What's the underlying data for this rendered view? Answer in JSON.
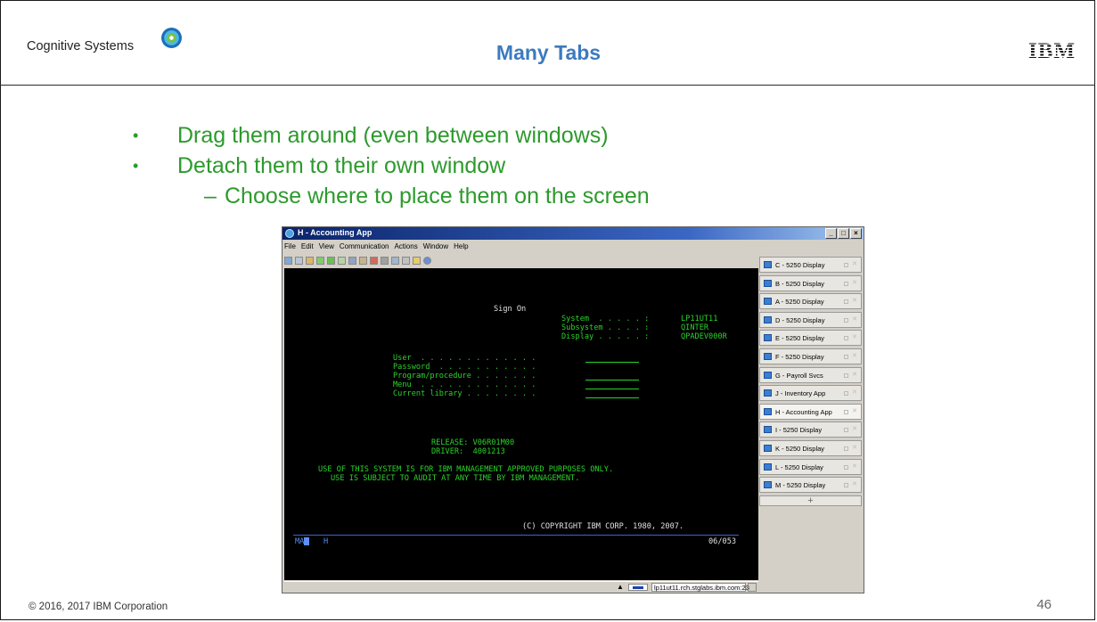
{
  "header": {
    "brand": "Cognitive Systems",
    "title": "Many Tabs",
    "ibm_logo": "IBM"
  },
  "bullets": [
    "Drag them around (even between windows)",
    "Detach them to their own window"
  ],
  "sub_bullets": [
    "Choose where to place them on the screen"
  ],
  "footer": {
    "copyright": "© 2016, 2017 IBM Corporation",
    "page_number": "46"
  },
  "app": {
    "title": "H - Accounting App",
    "window_buttons": [
      "_",
      "□",
      "×"
    ],
    "menu": [
      "File",
      "Edit",
      "View",
      "Communication",
      "Actions",
      "Window",
      "Help"
    ],
    "screen": {
      "heading": "Sign On",
      "system_label": "System  . . . . . :",
      "system_value": "LP11UT11",
      "subsystem_label": "Subsystem . . . . :",
      "subsystem_value": "QINTER",
      "display_label": "Display . . . . . :",
      "display_value": "QPADEV000R",
      "user_label": "User  . . . . . . . . . . . . .",
      "password_label": "Password  . . . . . . . . . . .",
      "program_label": "Program/procedure . . . . . . .",
      "menu_label": "Menu  . . . . . . . . . . . . .",
      "library_label": "Current library . . . . . . . .",
      "release": "RELEASE: V06R01M00",
      "driver": "DRIVER:  4001213",
      "notice1": "USE OF THIS SYSTEM IS FOR IBM MANAGEMENT APPROVED PURPOSES ONLY.",
      "notice2": "USE IS SUBJECT TO AUDIT AT ANY TIME BY IBM MANAGEMENT.",
      "copyright": "(C) COPYRIGHT IBM CORP. 1980, 2007.",
      "status_left": "MA",
      "status_mid": "H",
      "status_right": "06/053"
    },
    "status_host": "lp11ut11.rch.stglabs.ibm.com:23",
    "tabs": [
      "C - 5250 Display",
      "B - 5250 Display",
      "A - 5250 Display",
      "D - 5250 Display",
      "E - 5250 Display",
      "F - 5250 Display",
      "G - Payroll Svcs",
      "J - Inventory App",
      "H - Accounting App",
      "I - 5250 Display",
      "K - 5250 Display",
      "L - 5250 Display",
      "M - 5250 Display"
    ],
    "add_tab": "+"
  }
}
